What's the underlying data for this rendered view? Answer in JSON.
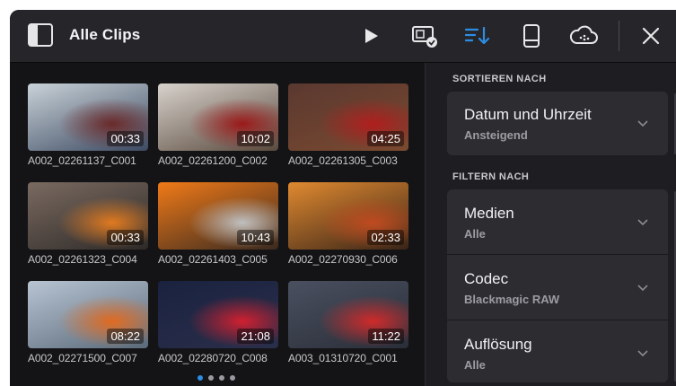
{
  "header": {
    "title": "Alle Clips",
    "icons": [
      "panel-toggle-icon",
      "play-icon",
      "card-check-icon",
      "sort-icon",
      "drive-icon",
      "cloud-icon",
      "close-icon"
    ],
    "accent": "#2d8de3"
  },
  "clips": [
    {
      "name": "A002_02261137_C001",
      "duration": "00:33",
      "thumb_colors": [
        "#c9d2d8",
        "#3d4a62",
        "#6a2a2a"
      ]
    },
    {
      "name": "A002_02261200_C002",
      "duration": "10:02",
      "thumb_colors": [
        "#d7d2cc",
        "#5a4a3e",
        "#9a1a1a"
      ]
    },
    {
      "name": "A002_02261305_C003",
      "duration": "04:25",
      "thumb_colors": [
        "#5a3830",
        "#7a4a30",
        "#b01e1e"
      ]
    },
    {
      "name": "A002_02261323_C004",
      "duration": "00:33",
      "thumb_colors": [
        "#7a6a60",
        "#2e2a28",
        "#e07a20"
      ]
    },
    {
      "name": "A002_02261403_C005",
      "duration": "10:43",
      "thumb_colors": [
        "#f07a18",
        "#3a2a20",
        "#c0c0c0"
      ]
    },
    {
      "name": "A002_02270930_C006",
      "duration": "02:33",
      "thumb_colors": [
        "#e08a30",
        "#3a2418",
        "#c04a20"
      ]
    },
    {
      "name": "A002_02271500_C007",
      "duration": "08:22",
      "thumb_colors": [
        "#b8c4d2",
        "#5a6a7a",
        "#e06a20"
      ]
    },
    {
      "name": "A002_02280720_C008",
      "duration": "21:08",
      "thumb_colors": [
        "#1a2240",
        "#2a2f4a",
        "#d02030"
      ]
    },
    {
      "name": "A003_01310720_C001",
      "duration": "11:22",
      "thumb_colors": [
        "#4a5060",
        "#2a2e38",
        "#d02a2a"
      ]
    }
  ],
  "pagination": {
    "pages": 4,
    "active": 1
  },
  "sort": {
    "label": "SORTIEREN NACH",
    "title": "Datum und Uhrzeit",
    "value": "Ansteigend"
  },
  "filter": {
    "label": "FILTERN NACH",
    "items": [
      {
        "title": "Medien",
        "value": "Alle"
      },
      {
        "title": "Codec",
        "value": "Blackmagic RAW"
      },
      {
        "title": "Auflösung",
        "value": "Alle"
      }
    ]
  }
}
